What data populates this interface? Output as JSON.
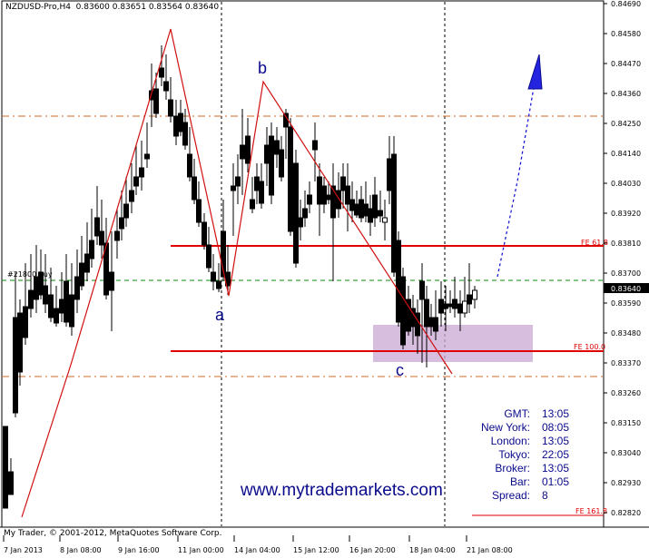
{
  "chart_header": "NZDUSD-Pro,H4  0.83600 0.83651 0.83564 0.83640",
  "order_label": "#21800 buy",
  "footer": "My Trader, © 2001-2012, MetaQuotes Software Corp.",
  "website": "www.mytrademarkets.com",
  "wave_labels": {
    "a": "a",
    "b": "b",
    "c": "c"
  },
  "fib_labels": {
    "fe618": "FE 61.8",
    "fe100": "FE 100.0",
    "fe1618": "FE 161.8"
  },
  "current_price": "0.83640",
  "price_ticks": [
    "0.84690",
    "0.84580",
    "0.84470",
    "0.84360",
    "0.84250",
    "0.84140",
    "0.84030",
    "0.83920",
    "0.83810",
    "0.83700",
    "0.83590",
    "0.83480",
    "0.83370",
    "0.83260",
    "0.83150",
    "0.83040",
    "0.82930",
    "0.82820"
  ],
  "time_ticks": [
    "7 Jan 2013",
    "8 Jan 08:00",
    "9 Jan 16:00",
    "11 Jan 00:00",
    "14 Jan 04:00",
    "15 Jan 12:00",
    "16 Jan 20:00",
    "18 Jan 04:00",
    "21 Jan 08:00"
  ],
  "clock": [
    {
      "label": "GMT:",
      "value": "13:05"
    },
    {
      "label": "New York:",
      "value": "08:05"
    },
    {
      "label": "London:",
      "value": "13:05"
    },
    {
      "label": "Tokyo:",
      "value": "22:05"
    },
    {
      "label": "Broker:",
      "value": "13:05"
    },
    {
      "label": "Bar:",
      "value": "01:05"
    },
    {
      "label": "Spread:",
      "value": "8"
    }
  ],
  "colors": {
    "fib_line": "#e00000",
    "zigzag": "#d01010",
    "wave_text": "#0a0a8c",
    "buy_zone": "#c9a8d4",
    "order_line": "#0a8a0a",
    "projection": "#1a1ad8"
  }
}
